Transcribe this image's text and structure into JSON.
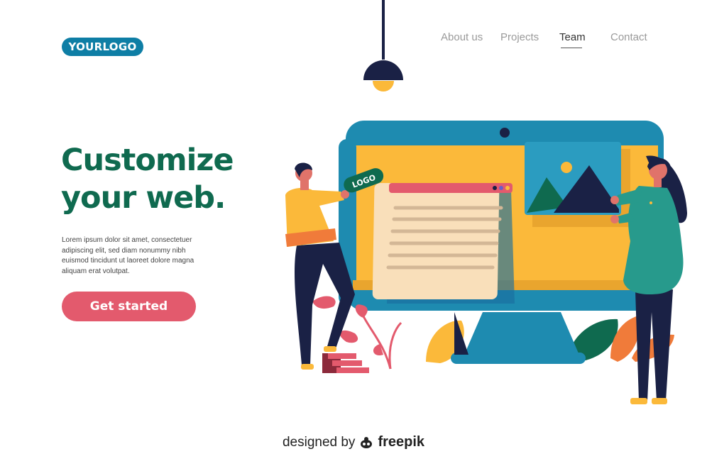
{
  "header": {
    "logo_text": "YOURLOGO",
    "nav": [
      {
        "label": "About us"
      },
      {
        "label": "Projects"
      },
      {
        "label": "Team",
        "active": true
      },
      {
        "label": "Contact"
      }
    ]
  },
  "hero": {
    "headline_line1": "Customize",
    "headline_line2": "your web.",
    "description": "Lorem ipsum dolor sit amet, consectetuer adipiscing elit, sed diam nonummy nibh euismod tincidunt ut laoreet dolore magna aliquam erat volutpat.",
    "cta_label": "Get started"
  },
  "illustration": {
    "logo_badge_text": "LOGO"
  },
  "footer": {
    "credit_prefix": "designed by",
    "credit_brand": "freepik"
  },
  "colors": {
    "brand_blue": "#0e7ea5",
    "headline_green": "#0f6a4f",
    "cta_pink": "#e35a6d",
    "monitor_yellow": "#fbb93a",
    "navy": "#1a2145"
  },
  "icons": [
    "freepik-bug-icon",
    "image-icon"
  ]
}
